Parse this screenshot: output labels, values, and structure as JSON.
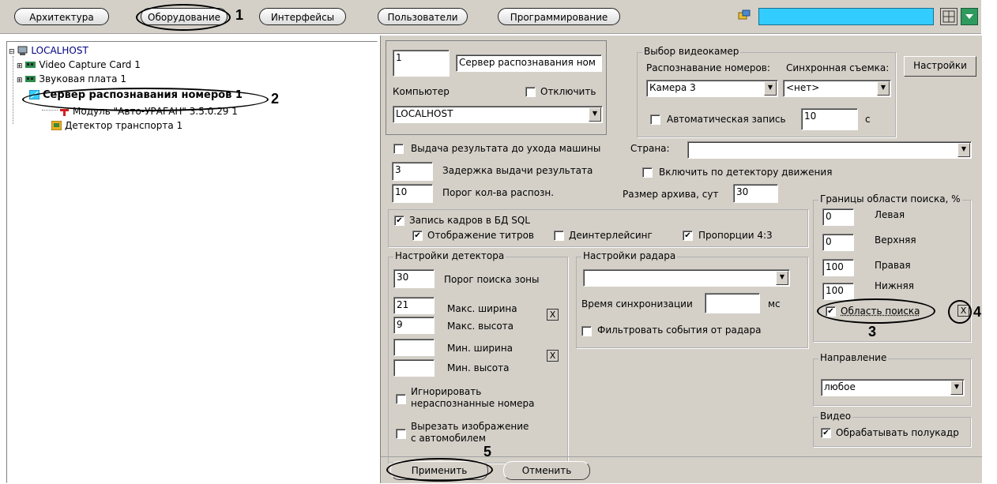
{
  "colors": {
    "panel": "#d4d0c8",
    "accent": "#33ccff",
    "green_button": "#2e9a5e"
  },
  "toolbar": {
    "tabs": [
      "Архитектура",
      "Оборудование",
      "Интерфейсы",
      "Пользователи",
      "Программирование"
    ],
    "icons": [
      "layout-icon",
      "chevron-down-icon",
      "app-icon"
    ]
  },
  "tree": {
    "root": "LOCALHOST",
    "items": [
      "Video Capture Card 1",
      "Звуковая плата 1",
      "Сервер распознавания номеров 1",
      "Модуль \"Авто-УРАГАН\" 3.5.0.29 1",
      "Детектор транспорта 1"
    ]
  },
  "form": {
    "id_value": "1",
    "name_value": "Сервер распознавания ном",
    "computer_label": "Компьютер",
    "disable_label": "Отключить",
    "computer_value": "LOCALHOST",
    "camera_group": "Выбор видеокамер",
    "recognition_label": "Распознавание номеров:",
    "sync_label": "Синхронная съемка:",
    "settings_button": "Настройки",
    "camera_value": "Камера 3",
    "sync_value": "<нет>",
    "auto_record_label": "Автоматическая запись",
    "auto_record_value": "10",
    "auto_record_unit": "с",
    "output_before_exit": "Выдача результата до ухода машины",
    "country_label": "Страна:",
    "country_value": "",
    "delay_value": "3",
    "delay_label": "Задержка выдачи результата",
    "motion_label": "Включить по детектору движения",
    "threshold_value": "10",
    "threshold_label": "Порог кол-ва распозн.",
    "archive_label": "Размер архива, сут",
    "archive_value": "30",
    "sql_record": "Запись кадров в БД SQL",
    "titles_display": "Отображение титров",
    "deinterlace": "Деинтерлейсинг",
    "aspect": "Пропорции 4:3",
    "detector_group": "Настройки детектора",
    "zone_threshold_value": "30",
    "zone_threshold_label": "Порог поиска зоны",
    "max_width_value": "21",
    "max_width_label": "Макс. ширина",
    "max_height_value": "9",
    "max_height_label": "Макс. высота",
    "min_width_value": "",
    "min_width_label": "Мин. ширина",
    "min_height_value": "",
    "min_height_label": "Мин. высота",
    "ignore_unrecognized": "Игнорировать\nнераспознанные номера",
    "cut_image": "Вырезать изображение\nс автомобилем",
    "radar_group": "Настройки радара",
    "radar_value": "",
    "sync_time_label": "Время синхронизации",
    "sync_time_value": "",
    "sync_time_unit": "мс",
    "filter_radar": "Фильтровать события от радара",
    "bounds_group": "Границы области поиска, %",
    "left_value": "0",
    "left_label": "Левая",
    "top_value": "0",
    "top_label": "Верхняя",
    "right_value": "100",
    "right_label": "Правая",
    "bottom_value": "100",
    "bottom_label": "Нижняя",
    "search_area": "Область поиска",
    "direction_group": "Направление",
    "direction_value": "любое",
    "video_group": "Видео",
    "half_frame": "Обрабатывать полукадр",
    "apply_button": "Применить",
    "cancel_button": "Отменить",
    "x_mark": "X",
    "check_mark": "✔",
    "drop_arrow": "▼"
  },
  "annotations": {
    "n1": "1",
    "n2": "2",
    "n3": "3",
    "n4": "4",
    "n5": "5"
  }
}
